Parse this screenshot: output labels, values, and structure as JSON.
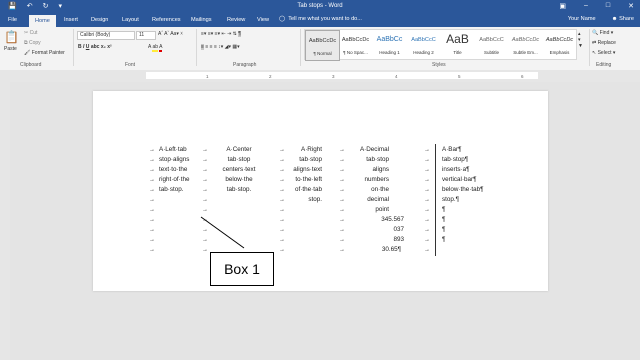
{
  "window": {
    "title": "Tab stops - Word",
    "controls": [
      "–",
      "□",
      "✕"
    ]
  },
  "tabs": [
    "File",
    "Home",
    "Insert",
    "Design",
    "Layout",
    "References",
    "Mailings",
    "Review",
    "View"
  ],
  "tellme": "Tell me what you want to do...",
  "user": {
    "name": "Your Name",
    "share": "Share"
  },
  "ribbon": {
    "clipboard": {
      "paste": "Paste",
      "cut": "Cut",
      "copy": "Copy",
      "format_painter": "Format Painter",
      "label": "Clipboard"
    },
    "font": {
      "face": "Calibri (Body)",
      "size": "11",
      "label": "Font"
    },
    "paragraph": {
      "label": "Paragraph"
    },
    "styles": {
      "label": "Styles",
      "items": [
        {
          "preview": "AaBbCcDc",
          "name": "¶ Normal"
        },
        {
          "preview": "AaBbCcDc",
          "name": "¶ No Spac..."
        },
        {
          "preview": "AaBbCc",
          "name": "Heading 1"
        },
        {
          "preview": "AaBbCcC",
          "name": "Heading 2"
        },
        {
          "preview": "AaB",
          "name": "Title"
        },
        {
          "preview": "AaBbCcC",
          "name": "Subtitle"
        },
        {
          "preview": "AaBbCcDc",
          "name": "Subtle Em..."
        },
        {
          "preview": "AaBbCcDc",
          "name": "Emphasis"
        }
      ]
    },
    "editing": {
      "find": "Find",
      "replace": "Replace",
      "select": "Select",
      "label": "Editing"
    }
  },
  "ruler": [
    "1",
    "2",
    "3",
    "4",
    "5",
    "6"
  ],
  "doc": {
    "col1": [
      "A·Left·tab",
      "stop·aligns",
      "text·to·the",
      "right·of·the",
      "tab·stop."
    ],
    "col2": [
      "A·Center",
      "tab·stop",
      "centers·text",
      "below·the",
      "tab·stop."
    ],
    "col3": [
      "A·Right",
      "tab·stop",
      "aligns·text",
      "to·the·left",
      "of·the·tab",
      "stop."
    ],
    "col4": [
      "A·Decimal",
      "tab·stop",
      "aligns",
      "numbers",
      "on·the",
      "decimal",
      "point",
      "345.567",
      "037",
      "893",
      "30.65¶"
    ],
    "col5": [
      "A·Bar¶",
      "tab·stop¶",
      "inserts·a¶",
      "vertical·bar¶",
      "below·the·tab¶",
      "stop.¶",
      "¶",
      "¶",
      "¶",
      "¶"
    ],
    "arrow": "→"
  },
  "callout": "Box 1"
}
